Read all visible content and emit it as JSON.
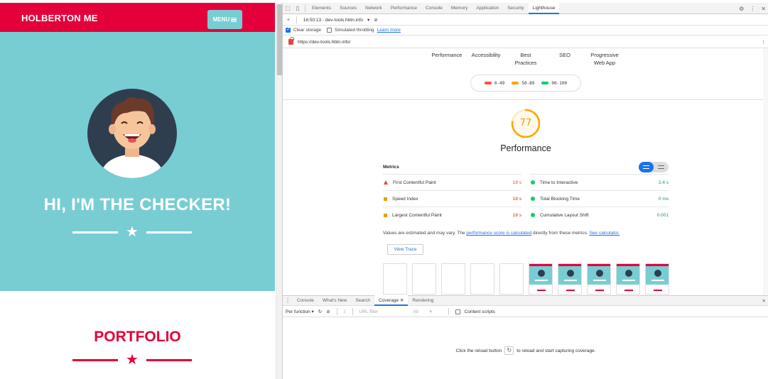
{
  "site": {
    "brand": "HOLBERTON ME",
    "menu_label": "MENU",
    "hero_title": "HI, I'M THE CHECKER!",
    "portfolio_title": "PORTFOLIO"
  },
  "devtools": {
    "tabs": [
      "Elements",
      "Sources",
      "Network",
      "Performance",
      "Console",
      "Memory",
      "Application",
      "Security",
      "Lighthouse"
    ],
    "active_tab": "Lighthouse",
    "report_select": "16:50:13 - dev-tools.hbtn.info",
    "clear_storage": "Clear storage",
    "simulated_throttling": "Simulated throttling",
    "learn_more": "Learn more",
    "url": "https://dev-tools.hbtn.info/",
    "categories": [
      "Performance",
      "Accessibility",
      "Best Practices",
      "SEO",
      "Progressive Web App"
    ],
    "legend": [
      {
        "label": "0-49",
        "color": "#ff4e42"
      },
      {
        "label": "50-89",
        "color": "#ffa400"
      },
      {
        "label": "90-100",
        "color": "#0cce6b"
      }
    ],
    "score": "77",
    "score_color": "#ffa400",
    "perf_title": "Performance",
    "metrics_label": "Metrics",
    "metrics": [
      {
        "name": "First Contentful Paint",
        "value": "18 s",
        "status": "fail"
      },
      {
        "name": "Time to Interactive",
        "value": "2.4 s",
        "status": "pass"
      },
      {
        "name": "Speed Index",
        "value": "18 s",
        "status": "average"
      },
      {
        "name": "Total Blocking Time",
        "value": "0 ms",
        "status": "pass"
      },
      {
        "name": "Largest Contentful Paint",
        "value": "18 s",
        "status": "average"
      },
      {
        "name": "Cumulative Layout Shift",
        "value": "0.001",
        "status": "pass"
      }
    ],
    "note_prefix": "Values are estimated and may vary. The ",
    "note_link": "performance score is calculated",
    "note_middle": " directly from these metrics. ",
    "note_link2": "See calculator.",
    "view_trace": "View Trace",
    "drawer_tabs": [
      "Console",
      "What's New",
      "Search",
      "Coverage",
      "Rendering"
    ],
    "drawer_active": "Coverage",
    "per_function": "Per function",
    "url_filter_placeholder": "URL filter",
    "type_filter": "All",
    "content_scripts": "Content scripts",
    "coverage_msg_pre": "Click the reload button",
    "coverage_msg_post": "to reload and start capturing coverage."
  }
}
